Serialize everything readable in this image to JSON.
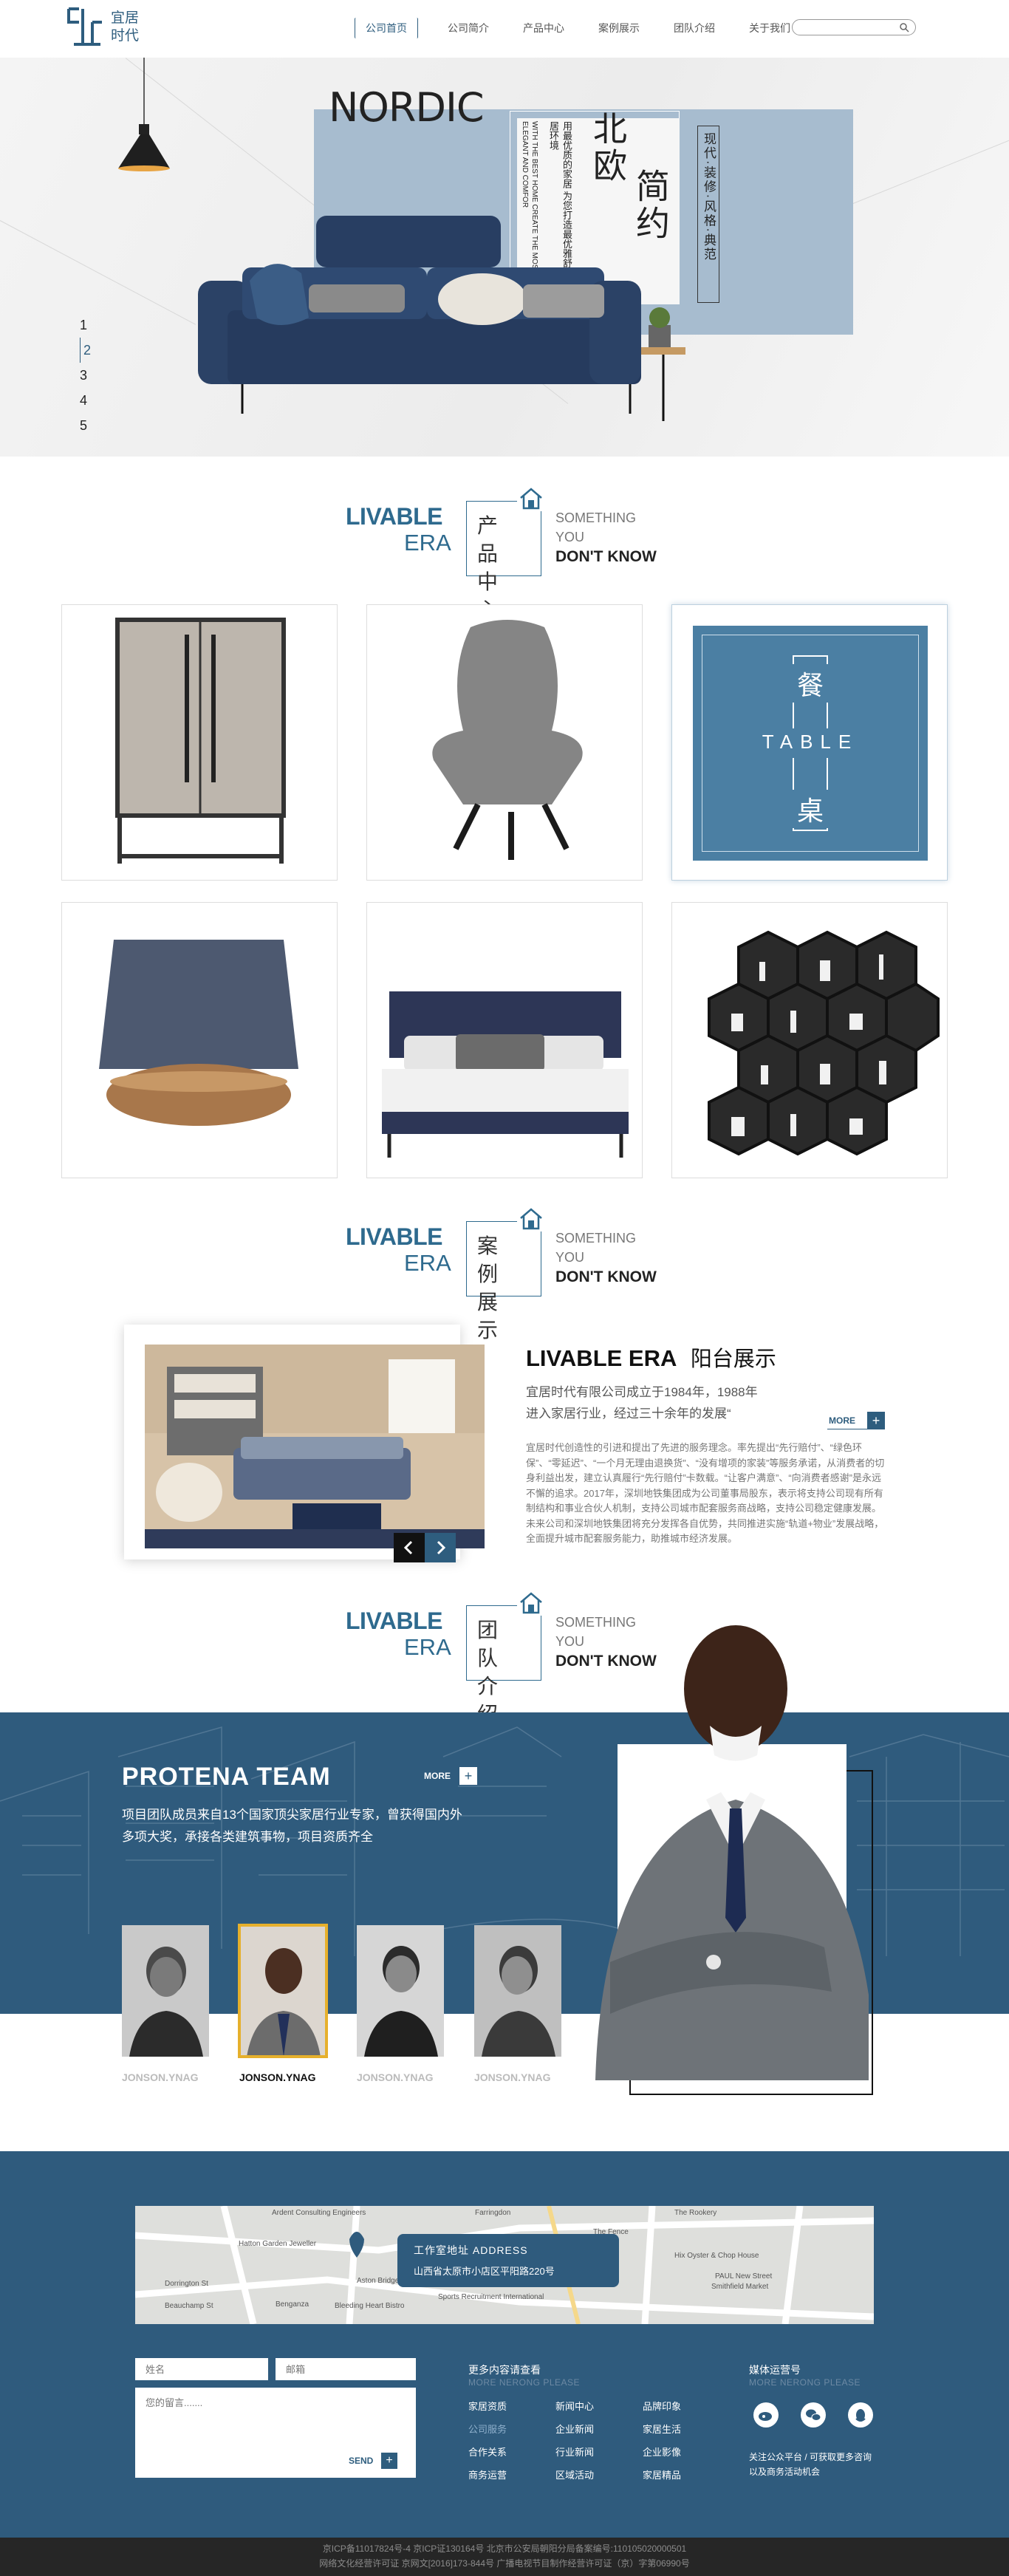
{
  "header": {
    "logo_line1": "宜居",
    "logo_line2": "时代",
    "nav": [
      "公司首页",
      "公司简介",
      "产品中心",
      "案例展示",
      "团队介绍",
      "关于我们"
    ],
    "search_placeholder": ""
  },
  "hero": {
    "nordic": "NORDIC",
    "vertical_en": "WITH THE BEST HOME CREATE THE MOST ELEGANT AND COMFOR",
    "vertical_cn": "用最优质的家居 为您打造最优雅舒适的家居环境",
    "title_cn_1": "北欧",
    "title_cn_2": "简约",
    "tags": "现代·装修·风格·典范",
    "slides": [
      "1",
      "2",
      "3",
      "4",
      "5"
    ],
    "current_slide": "2"
  },
  "products_section": {
    "livable": "LIVABLE",
    "era": "ERA",
    "cn": "产品中心",
    "something": "SOMETHING",
    "you": "YOU",
    "dont_know": "DON'T KNOW",
    "featured": {
      "cn_top": "餐",
      "en": "TABLE",
      "cn_bottom": "桌"
    }
  },
  "case_section": {
    "livable": "LIVABLE",
    "era": "ERA",
    "cn": "案例展示",
    "something": "SOMETHING",
    "you": "YOU",
    "dont_know": "DON'T KNOW",
    "title_en": "LIVABLE ERA",
    "title_cn": "阳台展示",
    "intro_line1": "宜居时代有限公司成立于1984年，1988年",
    "intro_line2": "进入家居行业，经过三十余年的发展“",
    "more": "MORE",
    "body": "宜居时代创造性的引进和提出了先进的服务理念。率先提出“先行赔付”、“绿色环保”、“零延迟”、“一个月无理由退换货”、“没有增项的家装”等服务承诺，从消费者的切身利益出发，建立认真履行“先行赔付”卡数载。“让客户满意”、“向消费者感谢”是永远不懈的追求。2017年，深圳地铁集团成为公司董事局股东，表示将支持公司现有所有制结构和事业合伙人机制，支持公司城市配套服务商战略，支持公司稳定健康发展。未来公司和深圳地铁集团将充分发挥各自优势，共同推进实施“轨道+物业”发展战略，全面提升城市配套服务能力，助推城市经济发展。"
  },
  "team_section": {
    "livable": "LIVABLE",
    "era": "ERA",
    "cn": "团队介绍",
    "something": "SOMETHING",
    "you": "YOU",
    "dont_know": "DON'T KNOW",
    "team_title": "PROTENA TEAM",
    "more": "MORE",
    "desc_line1": "项目团队成员来自13个国家顶尖家居行业专家，曾获得国内外",
    "desc_line2": "多项大奖，承接各类建筑事物，项目资质齐全",
    "members": [
      {
        "name": "JONSON.YNAG",
        "active": false
      },
      {
        "name": "JONSON.YNAG",
        "active": true
      },
      {
        "name": "JONSON.YNAG",
        "active": false
      },
      {
        "name": "JONSON.YNAG",
        "active": false
      }
    ]
  },
  "footer": {
    "map_labels": [
      "Farringdon",
      "The Rookery",
      "Hatton Garden Jeweller",
      "Ardent Consulting Engineers",
      "The Fence",
      "Hix Oyster & Chop House",
      "PAUL New Street",
      "Smithfield Market",
      "Beauchamp St",
      "Dorrington St",
      "Bleeding Heart Bistro",
      "Benganza",
      "Sports Recruitment International",
      "Aston Bridge Studios"
    ],
    "address_title": "工作室地址 ADDRESS",
    "address": "山西省太原市小店区平阳路220号",
    "name_placeholder": "姓名",
    "email_placeholder": "邮箱",
    "message_placeholder": "您的留言.......",
    "send": "SEND",
    "col1_title": "更多内容请查看",
    "col1_sub": "MORE NERONG PLEASE",
    "links": [
      [
        "家居资质",
        "新闻中心",
        "品牌印象"
      ],
      [
        "公司服务",
        "企业新闻",
        "家居生活"
      ],
      [
        "合作关系",
        "行业新闻",
        "企业影像"
      ],
      [
        "商务运营",
        "区域活动",
        "家居精品"
      ]
    ],
    "col2_title": "媒体运营号",
    "col2_sub": "MORE NERONG PLEASE",
    "follow_line1": "关注公众平台 / 可获取更多咨询",
    "follow_line2": "以及商务活动机会",
    "social_icons": [
      "weibo-icon",
      "wechat-icon",
      "qq-icon"
    ]
  },
  "bottom_bar": {
    "line1": "京ICP备11017824号-4 京ICP证130164号 北京市公安局朝阳分局备案编号:110105020000501",
    "line2": "网络文化经营许可证 京网文[2016]173-844号 广播电视节目制作经营许可证（京）字第06990号"
  }
}
